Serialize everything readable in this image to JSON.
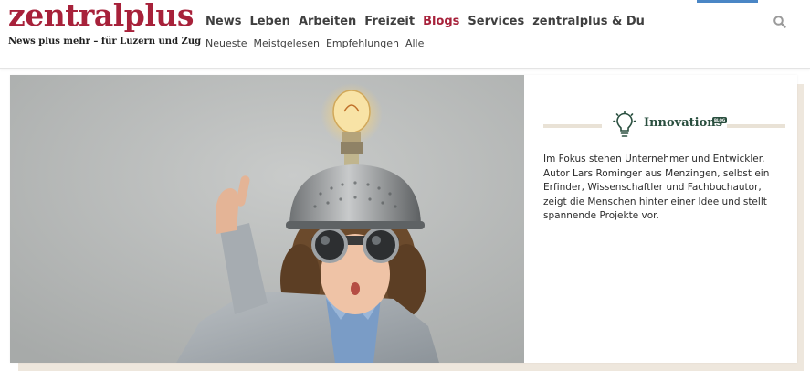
{
  "brand": {
    "name": "zentralplus",
    "tagline": "News plus mehr – für Luzern und Zug",
    "accent_color": "#a7213a"
  },
  "main_nav": [
    {
      "label": "News",
      "active": false
    },
    {
      "label": "Leben",
      "active": false
    },
    {
      "label": "Arbeiten",
      "active": false
    },
    {
      "label": "Freizeit",
      "active": false
    },
    {
      "label": "Blogs",
      "active": true
    },
    {
      "label": "Services",
      "active": false
    },
    {
      "label": "zentralplus & Du",
      "active": false
    }
  ],
  "sub_nav": [
    {
      "label": "Neueste"
    },
    {
      "label": "Meistgelesen"
    },
    {
      "label": "Empfehlungen"
    },
    {
      "label": "Alle"
    }
  ],
  "search": {
    "icon": "search-icon"
  },
  "blog": {
    "icon": "lightbulb-icon",
    "title": "Innovations",
    "badge": "BLOG",
    "title_color": "#2a4f3f",
    "description": "Im Fokus stehen Unternehmer und Entwickler. Autor Lars Rominger aus Menzingen, selbst ein Erfinder, Wissenschaftler und Fachbuchautor, zeigt die Menschen hinter einer Idee und stellt spannende Projekte vor."
  }
}
